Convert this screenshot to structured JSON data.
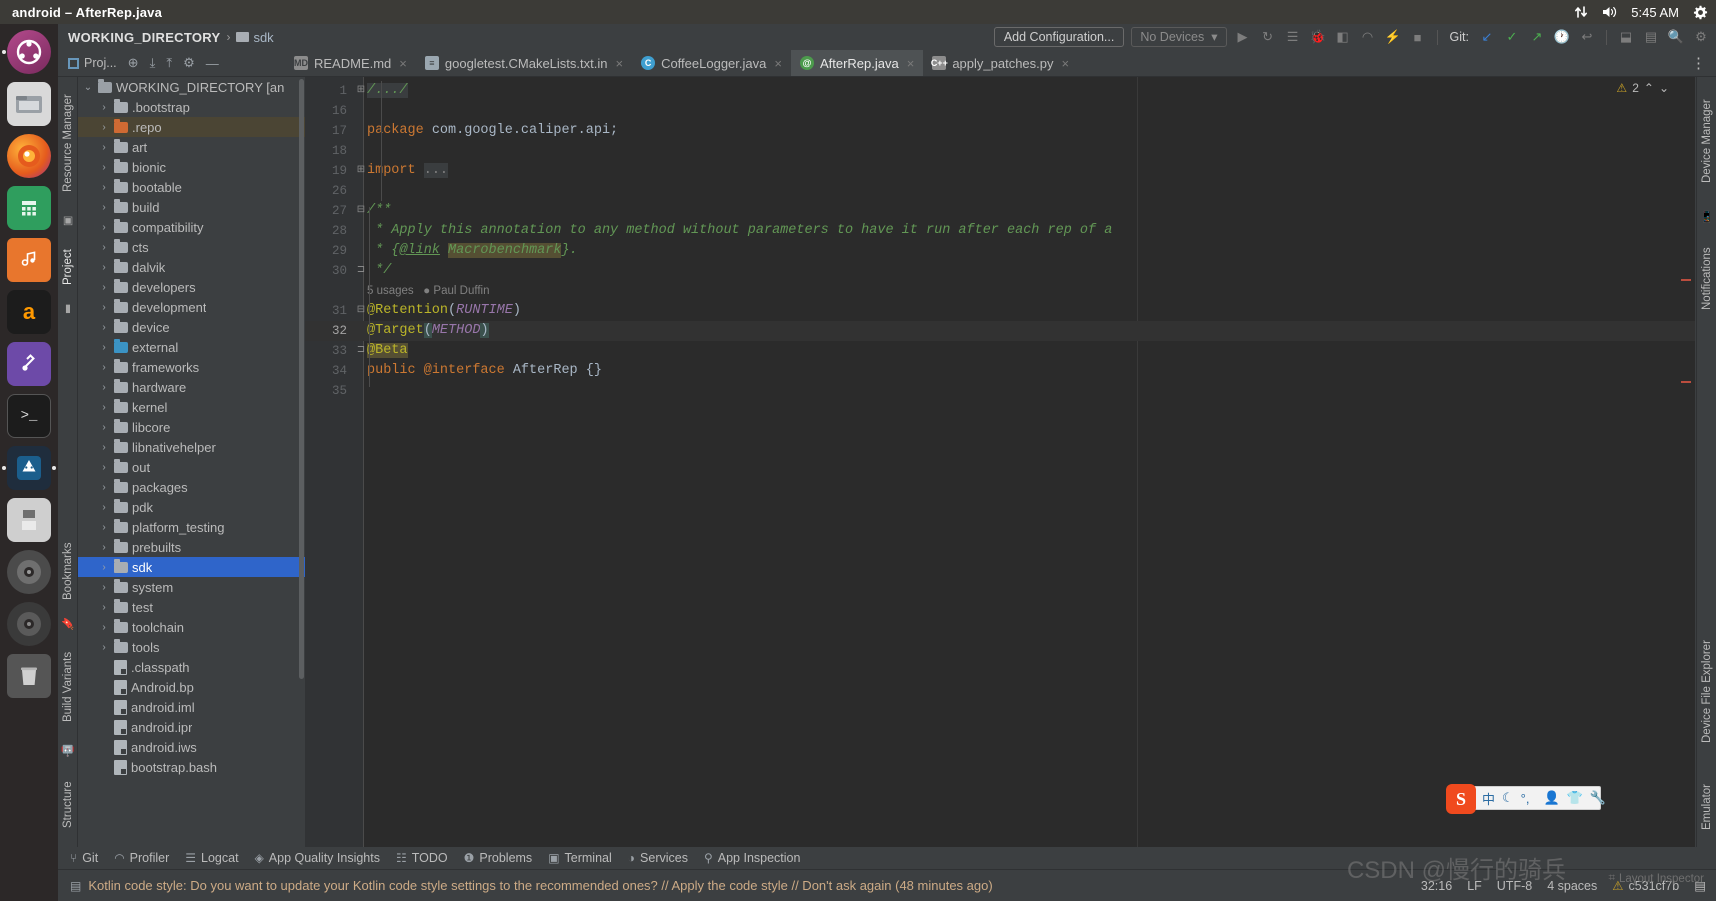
{
  "window": {
    "title": "android – AfterRep.java"
  },
  "tray": {
    "network_icon": "network-updown-icon",
    "volume_icon": "volume-icon",
    "clock": "5:45 AM",
    "settings_icon": "gear-icon"
  },
  "launcher": {
    "items": [
      {
        "name": "ubuntu-dash",
        "glyph": "◉"
      },
      {
        "name": "files",
        "glyph": "🗄"
      },
      {
        "name": "firefox",
        "glyph": ""
      },
      {
        "name": "calculator",
        "glyph": "▦"
      },
      {
        "name": "rhythmbox",
        "glyph": "♪"
      },
      {
        "name": "amazon",
        "glyph": "a"
      },
      {
        "name": "software-center",
        "glyph": "🛠"
      },
      {
        "name": "terminal",
        "glyph": ">_"
      },
      {
        "name": "android-studio",
        "glyph": "🤖"
      },
      {
        "name": "disk",
        "glyph": "💾"
      },
      {
        "name": "dvd-1",
        "glyph": "◎"
      },
      {
        "name": "dvd-2",
        "glyph": "◎"
      },
      {
        "name": "trash",
        "glyph": "🗑"
      }
    ]
  },
  "navbar": {
    "breadcrumb_root": "WORKING_DIRECTORY",
    "breadcrumb_sep": "›",
    "breadcrumb_leaf": "sdk",
    "add_configuration": "Add Configuration...",
    "device_selector": "No Devices",
    "device_caret": "▾",
    "git_label": "Git:",
    "toolbar_icons": [
      {
        "name": "run-icon",
        "glyph": "▶"
      },
      {
        "name": "rerun-icon",
        "glyph": "↻"
      },
      {
        "name": "run-with-coverage-icon",
        "glyph": "☰"
      },
      {
        "name": "debug-icon",
        "glyph": "🐞"
      },
      {
        "name": "attach-debugger-icon",
        "glyph": "◧"
      },
      {
        "name": "profile-icon",
        "glyph": "◠"
      },
      {
        "name": "apply-changes-icon",
        "glyph": "⚡"
      },
      {
        "name": "stop-icon",
        "glyph": "■"
      }
    ],
    "git_icons": [
      {
        "name": "update-project-icon",
        "glyph": "↙"
      },
      {
        "name": "commit-icon",
        "glyph": "✓"
      },
      {
        "name": "push-icon",
        "glyph": "↗"
      },
      {
        "name": "history-icon",
        "glyph": "🕐"
      },
      {
        "name": "rollback-icon",
        "glyph": "↩"
      }
    ],
    "right_icons": [
      {
        "name": "sdk-manager-icon",
        "glyph": "⬓"
      },
      {
        "name": "avd-manager-icon",
        "glyph": "▤"
      },
      {
        "name": "search-icon",
        "glyph": "🔍"
      },
      {
        "name": "settings-icon",
        "glyph": "⚙"
      }
    ]
  },
  "tool_header": {
    "title": "Proj...",
    "icons": [
      {
        "name": "locate-icon",
        "glyph": "⊕"
      },
      {
        "name": "expand-all-icon",
        "glyph": "⤓"
      },
      {
        "name": "collapse-all-icon",
        "glyph": "⤒"
      },
      {
        "name": "settings-icon",
        "glyph": "⚙"
      },
      {
        "name": "hide-icon",
        "glyph": "—"
      }
    ]
  },
  "tabs": [
    {
      "label": "README.md",
      "icon": "markdown-file-icon",
      "icon_text": "MD",
      "active": false,
      "closable": true
    },
    {
      "label": "googletest.CMakeLists.txt.in",
      "icon": "text-file-icon",
      "icon_text": "≡",
      "active": false,
      "closable": true
    },
    {
      "label": "CoffeeLogger.java",
      "icon": "java-class-icon",
      "icon_text": "C",
      "active": false,
      "closable": true
    },
    {
      "label": "AfterRep.java",
      "icon": "java-annotation-icon",
      "icon_text": "@",
      "active": true,
      "closable": true
    },
    {
      "label": "apply_patches.py",
      "icon": "python-file-icon",
      "icon_text": "C++",
      "active": false,
      "closable": true
    }
  ],
  "left_strips": [
    {
      "label": "Resource Manager",
      "name": "tool-tab-resource-manager"
    },
    {
      "label": "Project",
      "name": "tool-tab-project"
    },
    {
      "label": "Bookmarks",
      "name": "tool-tab-bookmarks"
    },
    {
      "label": "Build Variants",
      "name": "tool-tab-build-variants"
    },
    {
      "label": "Structure",
      "name": "tool-tab-structure"
    }
  ],
  "right_strips": [
    {
      "label": "Device Manager",
      "name": "tool-tab-device-manager"
    },
    {
      "label": "Notifications",
      "name": "tool-tab-notifications"
    },
    {
      "label": "Device File Explorer",
      "name": "tool-tab-device-file-explorer"
    },
    {
      "label": "Emulator",
      "name": "tool-tab-emulator"
    }
  ],
  "tree": [
    {
      "label": "WORKING_DIRECTORY [an",
      "depth": 0,
      "arrow": "⌄",
      "icon": "module",
      "state": "normal"
    },
    {
      "label": ".bootstrap",
      "depth": 1,
      "arrow": "›",
      "icon": "folder",
      "state": "normal"
    },
    {
      "label": ".repo",
      "depth": 1,
      "arrow": "›",
      "icon": "folder-orange",
      "state": "highlight"
    },
    {
      "label": "art",
      "depth": 1,
      "arrow": "›",
      "icon": "folder",
      "state": "normal"
    },
    {
      "label": "bionic",
      "depth": 1,
      "arrow": "›",
      "icon": "folder",
      "state": "normal"
    },
    {
      "label": "bootable",
      "depth": 1,
      "arrow": "›",
      "icon": "folder",
      "state": "normal"
    },
    {
      "label": "build",
      "depth": 1,
      "arrow": "›",
      "icon": "folder",
      "state": "normal"
    },
    {
      "label": "compatibility",
      "depth": 1,
      "arrow": "›",
      "icon": "folder",
      "state": "normal"
    },
    {
      "label": "cts",
      "depth": 1,
      "arrow": "›",
      "icon": "folder",
      "state": "normal"
    },
    {
      "label": "dalvik",
      "depth": 1,
      "arrow": "›",
      "icon": "folder",
      "state": "normal"
    },
    {
      "label": "developers",
      "depth": 1,
      "arrow": "›",
      "icon": "folder",
      "state": "normal"
    },
    {
      "label": "development",
      "depth": 1,
      "arrow": "›",
      "icon": "folder",
      "state": "normal"
    },
    {
      "label": "device",
      "depth": 1,
      "arrow": "›",
      "icon": "folder",
      "state": "normal"
    },
    {
      "label": "external",
      "depth": 1,
      "arrow": "›",
      "icon": "folder-blue",
      "state": "normal"
    },
    {
      "label": "frameworks",
      "depth": 1,
      "arrow": "›",
      "icon": "folder",
      "state": "normal"
    },
    {
      "label": "hardware",
      "depth": 1,
      "arrow": "›",
      "icon": "folder",
      "state": "normal"
    },
    {
      "label": "kernel",
      "depth": 1,
      "arrow": "›",
      "icon": "folder",
      "state": "normal"
    },
    {
      "label": "libcore",
      "depth": 1,
      "arrow": "›",
      "icon": "folder",
      "state": "normal"
    },
    {
      "label": "libnativehelper",
      "depth": 1,
      "arrow": "›",
      "icon": "folder",
      "state": "normal"
    },
    {
      "label": "out",
      "depth": 1,
      "arrow": "›",
      "icon": "folder",
      "state": "normal"
    },
    {
      "label": "packages",
      "depth": 1,
      "arrow": "›",
      "icon": "folder",
      "state": "normal"
    },
    {
      "label": "pdk",
      "depth": 1,
      "arrow": "›",
      "icon": "folder",
      "state": "normal"
    },
    {
      "label": "platform_testing",
      "depth": 1,
      "arrow": "›",
      "icon": "folder",
      "state": "normal"
    },
    {
      "label": "prebuilts",
      "depth": 1,
      "arrow": "›",
      "icon": "folder",
      "state": "normal"
    },
    {
      "label": "sdk",
      "depth": 1,
      "arrow": "›",
      "icon": "folder",
      "state": "selected"
    },
    {
      "label": "system",
      "depth": 1,
      "arrow": "›",
      "icon": "folder",
      "state": "normal"
    },
    {
      "label": "test",
      "depth": 1,
      "arrow": "›",
      "icon": "folder",
      "state": "normal"
    },
    {
      "label": "toolchain",
      "depth": 1,
      "arrow": "›",
      "icon": "folder",
      "state": "normal"
    },
    {
      "label": "tools",
      "depth": 1,
      "arrow": "›",
      "icon": "folder",
      "state": "normal"
    },
    {
      "label": ".classpath",
      "depth": 1,
      "arrow": "",
      "icon": "file",
      "state": "normal"
    },
    {
      "label": "Android.bp",
      "depth": 1,
      "arrow": "",
      "icon": "file",
      "state": "normal"
    },
    {
      "label": "android.iml",
      "depth": 1,
      "arrow": "",
      "icon": "file",
      "state": "normal"
    },
    {
      "label": "android.ipr",
      "depth": 1,
      "arrow": "",
      "icon": "file",
      "state": "normal"
    },
    {
      "label": "android.iws",
      "depth": 1,
      "arrow": "",
      "icon": "file",
      "state": "normal"
    },
    {
      "label": "bootstrap.bash",
      "depth": 1,
      "arrow": "",
      "icon": "file",
      "state": "normal"
    }
  ],
  "editor": {
    "warning_count": "2",
    "warning_glyph": "⚠",
    "collapse_glyph": "⌃",
    "expand_glyph": "⌄",
    "lines": [
      {
        "num": "1",
        "fold": "⊞",
        "kind": "folded-comment",
        "text": "/.../"
      },
      {
        "num": "16",
        "fold": "",
        "kind": "plain",
        "text": ""
      },
      {
        "num": "17",
        "fold": "",
        "kind": "package",
        "keyword": "package",
        "rest": " com.google.caliper.api;"
      },
      {
        "num": "18",
        "fold": "",
        "kind": "plain",
        "text": ""
      },
      {
        "num": "19",
        "fold": "⊞",
        "kind": "import",
        "keyword": "import",
        "rest": " ",
        "folded": "..."
      },
      {
        "num": "26",
        "fold": "",
        "kind": "plain",
        "text": ""
      },
      {
        "num": "27",
        "fold": "⊟",
        "kind": "comment",
        "text": "/**"
      },
      {
        "num": "28",
        "fold": "",
        "kind": "comment",
        "text": " * Apply this annotation to any method without parameters to have it run after each rep of a"
      },
      {
        "num": "29",
        "fold": "",
        "kind": "comment-link",
        "pre": " * {",
        "link": "@link",
        "mid": " ",
        "hl": "Macrobenchmark",
        "post": "}."
      },
      {
        "num": "30",
        "fold": "⊐",
        "kind": "comment",
        "text": " */"
      },
      {
        "num": "",
        "fold": "",
        "kind": "hint",
        "usages": "5 usages",
        "author_icon": "👤",
        "author": "Paul Duffin"
      },
      {
        "num": "31",
        "fold": "⊟",
        "kind": "annotation",
        "anno": "@Retention",
        "open": "(",
        "arg": "RUNTIME",
        "close": ")"
      },
      {
        "num": "32",
        "fold": "",
        "kind": "annotation-caret",
        "anno": "@Target",
        "open": "(",
        "arg": "METHOD",
        "close": ")"
      },
      {
        "num": "33",
        "fold": "⊐",
        "kind": "annotation-hl",
        "anno": "@Beta"
      },
      {
        "num": "34",
        "fold": "",
        "kind": "declaration",
        "kw1": "public ",
        "kw2": "@interface",
        "name": " AfterRep {}"
      },
      {
        "num": "35",
        "fold": "",
        "kind": "plain",
        "text": ""
      }
    ]
  },
  "bottom_tabs": [
    {
      "label": "Git",
      "icon_glyph": "⑂",
      "name": "bottom-tab-git"
    },
    {
      "label": "Profiler",
      "icon_glyph": "◠",
      "name": "bottom-tab-profiler"
    },
    {
      "label": "Logcat",
      "icon_glyph": "☰",
      "name": "bottom-tab-logcat"
    },
    {
      "label": "App Quality Insights",
      "icon_glyph": "◈",
      "name": "bottom-tab-app-quality-insights"
    },
    {
      "label": "TODO",
      "icon_glyph": "☷",
      "name": "bottom-tab-todo"
    },
    {
      "label": "Problems",
      "icon_glyph": "❶",
      "name": "bottom-tab-problems"
    },
    {
      "label": "Terminal",
      "icon_glyph": "▣",
      "name": "bottom-tab-terminal"
    },
    {
      "label": "Services",
      "icon_glyph": "◑",
      "name": "bottom-tab-services"
    },
    {
      "label": "App Inspection",
      "icon_glyph": "⚲",
      "name": "bottom-tab-app-inspection"
    }
  ],
  "status_bar": {
    "notification_icon": "notification-icon",
    "message": "Kotlin code style: Do you want to update your Kotlin code style settings to the recommended ones? // Apply the code style // Don't ask again (48 minutes ago)",
    "caret_position": "32:16",
    "line_separator": "LF",
    "encoding": "UTF-8",
    "indent": "4 spaces",
    "branch": "c531cf7b",
    "branch_warning_glyph": "⚠",
    "layout_inspector": "Layout Inspector",
    "layout_inspector_icon": "layout-inspector-icon",
    "watermark": "CSDN @慢行的骑兵"
  },
  "ime": {
    "logo": "S",
    "mode": "中",
    "moon": "☾",
    "punct": "°,",
    "keyboard_icon": "keyboard-icon",
    "user_icon": "user-icon",
    "skin_icon": "shirt-icon",
    "tool_icon": "wrench-icon"
  }
}
